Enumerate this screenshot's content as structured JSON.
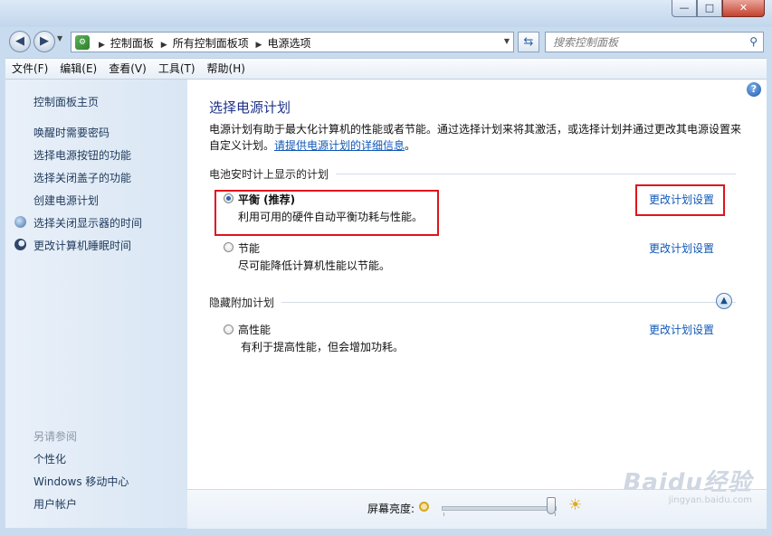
{
  "window": {
    "controls": [
      "—",
      "□",
      "✕"
    ]
  },
  "address_bar": {
    "crumbs": [
      "控制面板",
      "所有控制面板项",
      "电源选项"
    ],
    "search_placeholder": "搜索控制面板"
  },
  "menu": [
    "文件(F)",
    "编辑(E)",
    "查看(V)",
    "工具(T)",
    "帮助(H)"
  ],
  "sidebar": {
    "home": "控制面板主页",
    "links": [
      "唤醒时需要密码",
      "选择电源按钮的功能",
      "选择关闭盖子的功能",
      "创建电源计划",
      "选择关闭显示器的时间",
      "更改计算机睡眠时间"
    ],
    "see_also_title": "另请参阅",
    "see_also": [
      "个性化",
      "Windows 移动中心",
      "用户帐户"
    ]
  },
  "content": {
    "title": "选择电源计划",
    "description": "电源计划有助于最大化计算机的性能或者节能。通过选择计划来将其激活，或选择计划并通过更改其电源设置来自定义计划。",
    "description_link": "请提供电源计划的详细信息",
    "description_end": "。",
    "section_battery": "电池安时计上显示的计划",
    "section_hidden": "隐藏附加计划",
    "plans": [
      {
        "name": "平衡 (推荐)",
        "desc": "利用可用的硬件自动平衡功耗与性能。",
        "link": "更改计划设置",
        "selected": true
      },
      {
        "name": "节能",
        "desc": "尽可能降低计算机性能以节能。",
        "link": "更改计划设置",
        "selected": false
      },
      {
        "name": "高性能",
        "desc": "有利于提高性能，但会增加功耗。",
        "link": "更改计划设置",
        "selected": false
      }
    ]
  },
  "brightness": {
    "label": "屏幕亮度:",
    "level": 0.95
  },
  "watermark": {
    "main": "Baidu经验",
    "sub": "jingyan.baidu.com"
  },
  "annotation_color": "#e0141b"
}
